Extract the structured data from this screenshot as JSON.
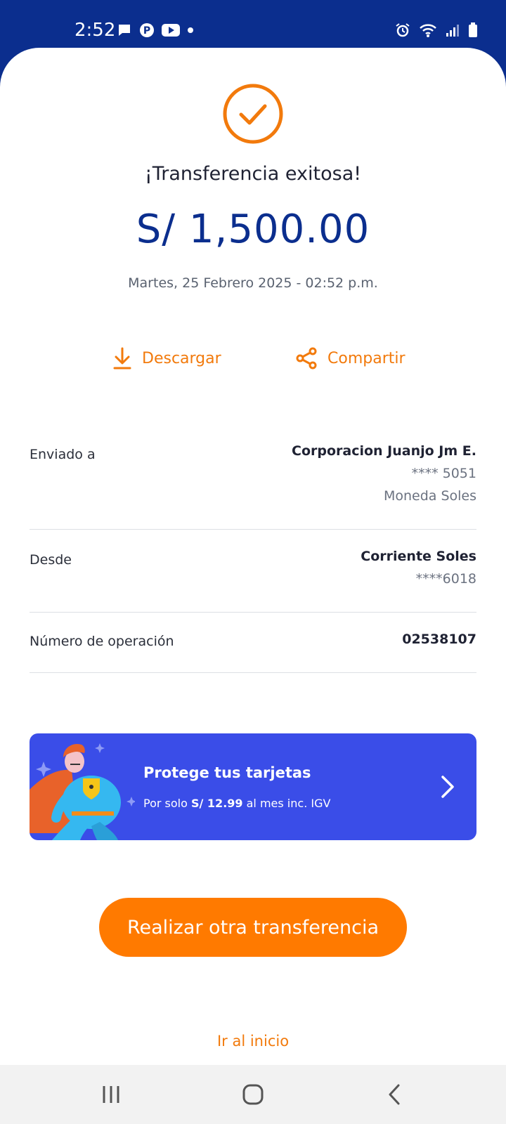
{
  "status_bar": {
    "time": "2:52",
    "left_icons": [
      "message-icon",
      "pinterest-icon",
      "youtube-icon",
      "dot-icon"
    ],
    "right_icons": [
      "alarm-icon",
      "wifi-icon",
      "signal-icon",
      "battery-icon"
    ]
  },
  "header": {
    "title": "¡Transferencia exitosa!",
    "amount": "S/ 1,500.00",
    "date": "Martes, 25 Febrero 2025 - 02:52 p.m."
  },
  "actions": {
    "download_label": "Descargar",
    "share_label": "Compartir"
  },
  "details": {
    "sent_to": {
      "label": "Enviado a",
      "name": "Corporacion Juanjo Jm E.",
      "account": "**** 5051",
      "currency": "Moneda Soles"
    },
    "from": {
      "label": "Desde",
      "account_type": "Corriente Soles",
      "account": "****6018"
    },
    "operation": {
      "label": "Número de operación",
      "number": "02538107"
    }
  },
  "promo": {
    "title": "Protege tus tarjetas",
    "sub_prefix": "Por solo ",
    "sub_price": "S/ 12.99",
    "sub_suffix": " al mes inc. IGV"
  },
  "cta": {
    "primary_label": "Realizar otra transferencia",
    "home_link": "Ir al inicio"
  },
  "colors": {
    "brand_blue": "#0b2e8e",
    "accent_orange": "#ff7a00",
    "promo_blue": "#3a4de8"
  }
}
